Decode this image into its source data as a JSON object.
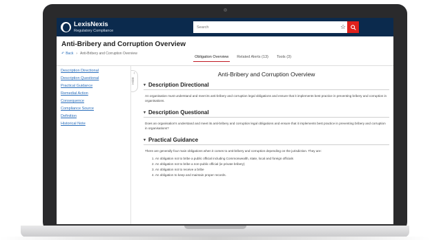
{
  "app": {
    "brand": "LexisNexis",
    "product": "Regulatory Compliance"
  },
  "search": {
    "placeholder": "Search",
    "star_icon": "star-icon",
    "button_icon": "search-icon"
  },
  "page": {
    "title": "Anti-Bribery and Corruption Overview",
    "back_label": "Back",
    "breadcrumb_current": "Anti-Bribery and Corruption Overview"
  },
  "tabs": [
    {
      "label": "Obligation Overview",
      "active": true
    },
    {
      "label": "Related Alerts (13)",
      "active": false
    },
    {
      "label": "Tools (3)",
      "active": false
    }
  ],
  "sidebar": {
    "items": [
      {
        "label": "Description Directional"
      },
      {
        "label": "Description Questional"
      },
      {
        "label": "Practical Guidance"
      },
      {
        "label": "Remedial Action"
      },
      {
        "label": "Consequence"
      },
      {
        "label": "Compliance Source"
      },
      {
        "label": "Definition"
      },
      {
        "label": "Historical Note"
      }
    ],
    "hide_label": "HIDE"
  },
  "main": {
    "title": "Anti-Bribery and Corruption Overview",
    "sections": [
      {
        "heading": "Description Directional",
        "body": "An organisation must understand and meet its anti-bribery and corruption legal obligations and ensure that it implements best practice in preventing bribery and corruption in organisations."
      },
      {
        "heading": "Description Questional",
        "body": "Does an organisation's understand and meet its anti-bribery and corruption legal obligations and ensure that it implements best practice in preventing bribery and corruption in organisations?"
      },
      {
        "heading": "Practical Guidance",
        "body": "There are generally four main obligations when it comes to anti-bribery and corruption depending on the jurisdiction. They are:",
        "list": [
          "1. An obligation not to bribe a public official including Commonwealth, state, local and foreign officials",
          "2. An obligation not to bribe a non-public official (ie private bribery)",
          "3. An obligation not to receive a bribe",
          "4. An obligation to keep and maintain proper records."
        ]
      }
    ]
  },
  "colors": {
    "topbar": "#0b2a4d",
    "accent": "#e0211c",
    "link": "#2a6ebb"
  }
}
